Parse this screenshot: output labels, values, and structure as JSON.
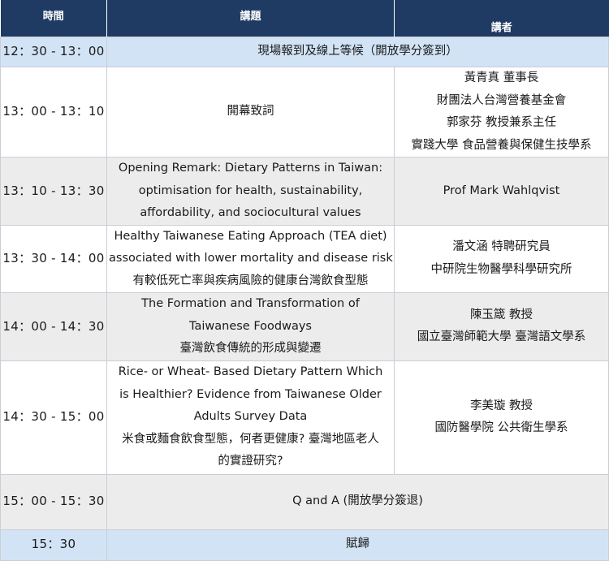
{
  "header": {
    "time": "時間",
    "topic": "講題",
    "speaker": "講者"
  },
  "rows": [
    {
      "time": "12：30 - 13：00",
      "topic": [
        "現場報到及線上等候（開放學分簽到）"
      ],
      "speaker": []
    },
    {
      "time": "13：00 - 13：10",
      "topic": [
        "開幕致詞"
      ],
      "speaker": [
        "黃青真 董事長",
        "財團法人台灣營養基金會",
        "郭家芬 教授兼系主任",
        "實踐大學 食品營養與保健生技學系"
      ]
    },
    {
      "time": "13：10 - 13：30",
      "topic": [
        "Opening Remark: Dietary Patterns in Taiwan:",
        "optimisation for health, sustainability,",
        "affordability, and sociocultural values"
      ],
      "speaker": [
        "Prof Mark Wahlqvist"
      ]
    },
    {
      "time": "13：30 - 14：00",
      "topic": [
        "Healthy Taiwanese Eating Approach (TEA diet)",
        "associated with lower mortality and disease risk",
        "有較低死亡率與疾病風險的健康台灣飲食型態"
      ],
      "speaker": [
        "潘文涵 特聘研究員",
        "中研院生物醫學科學研究所"
      ]
    },
    {
      "time": "14：00 - 14：30",
      "topic": [
        "The Formation and Transformation of",
        "Taiwanese Foodways",
        "臺灣飲食傳統的形成與變遷"
      ],
      "speaker": [
        "陳玉箴 教授",
        "國立臺灣師範大學 臺灣語文學系"
      ]
    },
    {
      "time": "14：30 - 15：00",
      "topic": [
        "Rice- or Wheat- Based Dietary Pattern Which",
        "is Healthier? Evidence from Taiwanese Older",
        "Adults Survey Data",
        "米食或麵食飲食型態，何者更健康? 臺灣地區老人",
        "的實證研究?"
      ],
      "speaker": [
        "李美璇  教授",
        "國防醫學院 公共衛生學系"
      ]
    },
    {
      "time": "15：00 - 15：30",
      "topic": [
        "Q and A (開放學分簽退)"
      ],
      "speaker": []
    },
    {
      "time": "15：30",
      "topic": [
        "賦歸"
      ],
      "speaker": []
    }
  ]
}
